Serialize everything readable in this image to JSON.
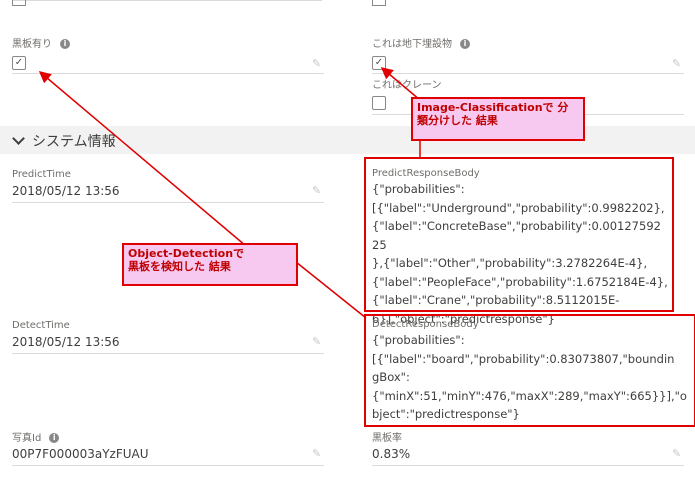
{
  "fields": {
    "blackboard": {
      "label": "黒板有り",
      "checked": true
    },
    "underground": {
      "label": "これは地下埋設物",
      "checked": true
    },
    "crane": {
      "label": "これはクレーン",
      "checked": false
    },
    "predict_time": {
      "label": "PredictTime",
      "value": "2018/05/12 13:56"
    },
    "predict_body": {
      "label": "PredictResponseBody",
      "lines": [
        "{\"probabilities\":",
        "[{\"label\":\"Underground\",\"probability\":0.9982202},",
        "{\"label\":\"ConcreteBase\",\"probability\":0.0012759225",
        "},{\"label\":\"Other\",\"probability\":3.2782264E-4},",
        "{\"label\":\"PeopleFace\",\"probability\":1.6752184E-4},",
        "{\"label\":\"Crane\",\"probability\":8.5112015E-",
        "6}],\"object\":\"predictresponse\"}"
      ]
    },
    "detect_time": {
      "label": "DetectTime",
      "value": "2018/05/12 13:56"
    },
    "detect_body": {
      "label": "DetectResponseBody",
      "lines": [
        "{\"probabilities\":",
        "[{\"label\":\"board\",\"probability\":0.83073807,\"boundin",
        "gBox\":",
        "{\"minX\":51,\"minY\":476,\"maxX\":289,\"maxY\":665}}],\"o",
        "bject\":\"predictresponse\"}"
      ]
    },
    "photo_id": {
      "label": "写真Id",
      "value": "00P7F000003aYzFUAU"
    },
    "blackboard_rate": {
      "label": "黒板率",
      "value": "0.83%"
    }
  },
  "section": {
    "title": "システム情報"
  },
  "callouts": {
    "classification": {
      "line1": "Image-Classificationで 分",
      "line2": "類分けした 結果"
    },
    "detection": {
      "line1": "Object-Detectionで",
      "line2": "黒板を検知した 結果"
    }
  },
  "colors": {
    "annotation_red": "#e00000",
    "callout_fill": "#f7c8f0",
    "section_bg": "#f3f2f2"
  }
}
